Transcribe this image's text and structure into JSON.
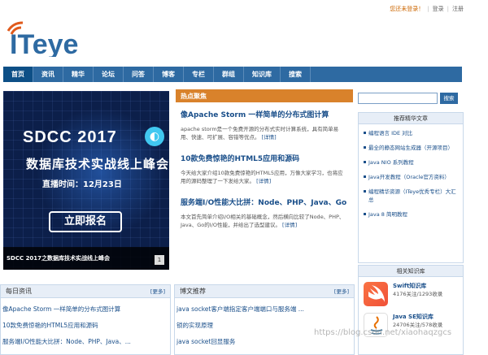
{
  "topbar": {
    "welcome": "您还未登录！",
    "sep1": "|",
    "login": "登录",
    "sep2": "|",
    "register": "注册"
  },
  "logo": {
    "text": "ITeye"
  },
  "nav": {
    "items": [
      "首页",
      "资讯",
      "精华",
      "论坛",
      "问答",
      "博客",
      "专栏",
      "群组",
      "知识库",
      "搜索"
    ]
  },
  "banner": {
    "title": "SDCC 2017",
    "subtitle": "数据库技术实战线上峰会",
    "time": "直播时间：12月23日",
    "button": "立即报名",
    "caption": "SDCC 2017之数据库技术实战线上峰会",
    "pager": "1"
  },
  "hot": {
    "header": "热点聚焦",
    "articles": [
      {
        "title": "像Apache Storm 一样简单的分布式图计算",
        "desc": "apache storm是一个免费开源的分布式实时计算系统，具有简单易用、快速、可扩展、容错等优点。",
        "more": "[详情]"
      },
      {
        "title": "10款免费惊艳的HTML5应用和源码",
        "desc": "今天给大家介绍10款免费惊艳的HTML5应用，万像大家学习，也将应用的源码整理了一下发给大家。",
        "more": "[详情]"
      },
      {
        "title": "服务端I/O性能大比拼：Node、PHP、Java、Go",
        "desc": "本文首先简单介绍I/O相关的基础概念，然后横向比较了Node、PHP、Java、Go的I/O性能，并给出了选型建议。",
        "more": "[详情]"
      }
    ]
  },
  "search": {
    "placeholder": "",
    "button": "搜索"
  },
  "recommend": {
    "header": "推荐精华文章",
    "items": [
      "编程语言 IDE 对比",
      "最全的静态网站生成器（开源项目）",
      "Java NIO 系列教程",
      "Java开发教程（Oracle官方资料）",
      "编程精华资源（ITeye优秀专栏）大汇总",
      "Java 8 简明教程"
    ]
  },
  "kb": {
    "header": "相关知识库",
    "entries": [
      {
        "name": "Swift知识库",
        "stat": "4176关注/1293收录"
      },
      {
        "name": "Java SE知识库",
        "stat": "24706关注/578收录"
      }
    ]
  },
  "daily": {
    "header": "每日资讯",
    "more": "[更多]",
    "items": [
      "像Apache Storm 一样简单的分布式图计算",
      "10款免费惊艳的HTML5应用和源码",
      "服务端I/O性能大比拼：Node、PHP、Java、..."
    ]
  },
  "blog": {
    "header": "博文推荐",
    "more": "[更多]",
    "items": [
      "java socket客户端指定客户端端口与服务端 ...",
      "锁的实现原理",
      "java socket回显服务"
    ]
  },
  "watermark": "https://blog.csdn.net/xiaohaqzgcs",
  "colors": {
    "nav": "#2e6aa2",
    "hot_header": "#d9822b",
    "link": "#1a4f8a",
    "brand_orange": "#e05a1c"
  }
}
